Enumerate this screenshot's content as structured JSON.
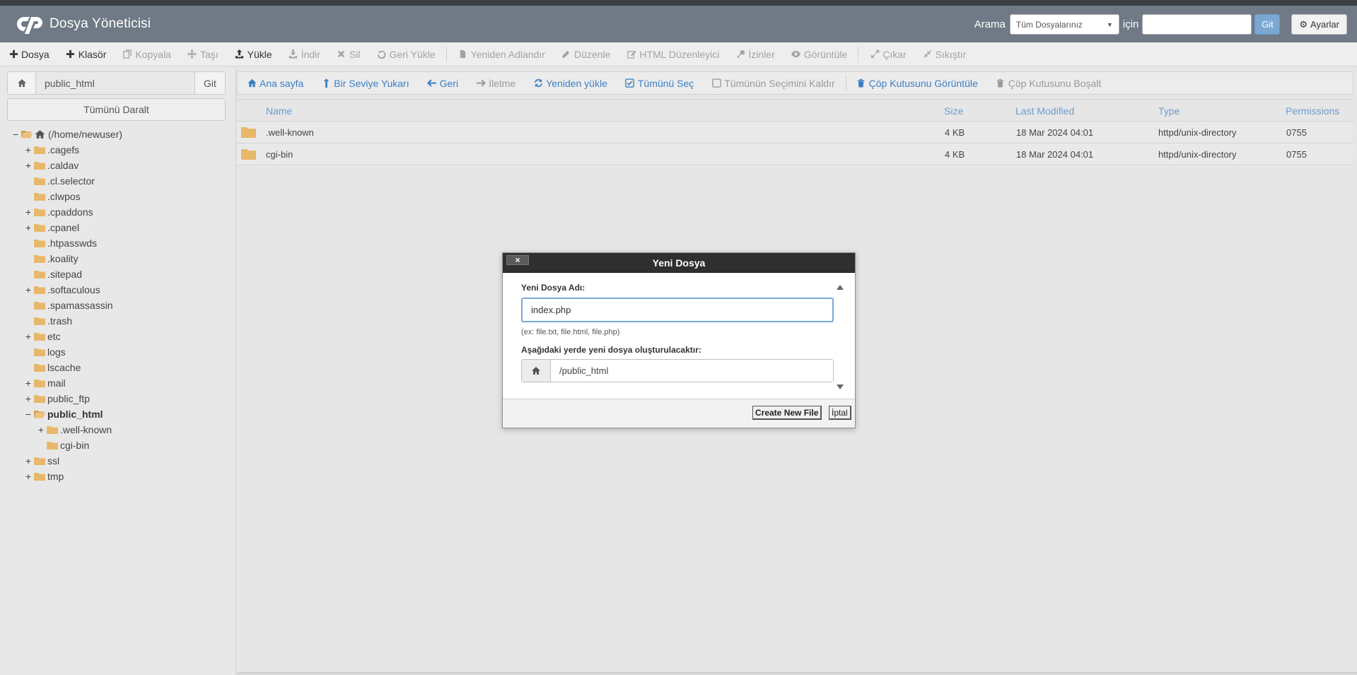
{
  "header": {
    "title": "Dosya Yöneticisi",
    "search_label": "Arama",
    "search_scope": "Tüm Dosyalarınız",
    "search_for": "için",
    "search_value": "",
    "search_go": "Git",
    "settings": "Ayarlar"
  },
  "toolbar": {
    "items": [
      {
        "label": "Dosya",
        "icon": "plus-icon",
        "enabled": true
      },
      {
        "label": "Klasör",
        "icon": "plus-icon",
        "enabled": true
      },
      {
        "label": "Kopyala",
        "icon": "copy-icon",
        "enabled": false
      },
      {
        "label": "Taşı",
        "icon": "move-icon",
        "enabled": false
      },
      {
        "label": "Yükle",
        "icon": "upload-icon",
        "enabled": true
      },
      {
        "label": "İndir",
        "icon": "download-icon",
        "enabled": false
      },
      {
        "label": "Sil",
        "icon": "close-icon",
        "enabled": false
      },
      {
        "label": "Geri Yükle",
        "icon": "undo-icon",
        "enabled": false
      },
      {
        "label": "Yeniden Adlandır",
        "icon": "file-icon",
        "enabled": false
      },
      {
        "label": "Düzenle",
        "icon": "pencil-icon",
        "enabled": false
      },
      {
        "label": "HTML Düzenleyici",
        "icon": "edit-icon",
        "enabled": false
      },
      {
        "label": "İzinler",
        "icon": "key-icon",
        "enabled": false
      },
      {
        "label": "Görüntüle",
        "icon": "eye-icon",
        "enabled": false
      },
      {
        "label": "Çıkar",
        "icon": "expand-icon",
        "enabled": false
      },
      {
        "label": "Sıkıştır",
        "icon": "compress-icon",
        "enabled": false
      }
    ]
  },
  "sidebar": {
    "path_value": "public_html",
    "go_label": "Git",
    "collapse_all": "Tümünü Daralt",
    "tree": [
      {
        "label": "(/home/newuser)",
        "level": 0,
        "toggle": "−",
        "home": true
      },
      {
        "label": ".cagefs",
        "level": 1,
        "toggle": "+"
      },
      {
        "label": ".caldav",
        "level": 1,
        "toggle": "+"
      },
      {
        "label": ".cl.selector",
        "level": 1,
        "toggle": ""
      },
      {
        "label": ".clwpos",
        "level": 1,
        "toggle": ""
      },
      {
        "label": ".cpaddons",
        "level": 1,
        "toggle": "+"
      },
      {
        "label": ".cpanel",
        "level": 1,
        "toggle": "+"
      },
      {
        "label": ".htpasswds",
        "level": 1,
        "toggle": ""
      },
      {
        "label": ".koality",
        "level": 1,
        "toggle": ""
      },
      {
        "label": ".sitepad",
        "level": 1,
        "toggle": ""
      },
      {
        "label": ".softaculous",
        "level": 1,
        "toggle": "+"
      },
      {
        "label": ".spamassassin",
        "level": 1,
        "toggle": ""
      },
      {
        "label": ".trash",
        "level": 1,
        "toggle": ""
      },
      {
        "label": "etc",
        "level": 1,
        "toggle": "+"
      },
      {
        "label": "logs",
        "level": 1,
        "toggle": ""
      },
      {
        "label": "lscache",
        "level": 1,
        "toggle": ""
      },
      {
        "label": "mail",
        "level": 1,
        "toggle": "+"
      },
      {
        "label": "public_ftp",
        "level": 1,
        "toggle": "+"
      },
      {
        "label": "public_html",
        "level": 1,
        "toggle": "−",
        "active": true,
        "open": true
      },
      {
        "label": ".well-known",
        "level": 2,
        "toggle": "+"
      },
      {
        "label": "cgi-bin",
        "level": 2,
        "toggle": ""
      },
      {
        "label": "ssl",
        "level": 1,
        "toggle": "+"
      },
      {
        "label": "tmp",
        "level": 1,
        "toggle": "+"
      }
    ]
  },
  "nav": {
    "items": [
      {
        "label": "Ana sayfa",
        "icon": "home-icon",
        "enabled": true
      },
      {
        "label": "Bir Seviye Yukarı",
        "icon": "level-up-icon",
        "enabled": true
      },
      {
        "label": "Geri",
        "icon": "arrow-left-icon",
        "enabled": true
      },
      {
        "label": "İletme",
        "icon": "arrow-right-icon",
        "enabled": false
      },
      {
        "label": "Yeniden yükle",
        "icon": "refresh-icon",
        "enabled": true
      },
      {
        "label": "Tümünü Seç",
        "icon": "checkbox-checked-icon",
        "enabled": true
      },
      {
        "label": "Tümünün Seçimini Kaldır",
        "icon": "checkbox-empty-icon",
        "enabled": false
      },
      {
        "label": "Çöp Kutusunu Görüntüle",
        "icon": "trash-icon",
        "enabled": true
      },
      {
        "label": "Çöp Kutusunu Boşalt",
        "icon": "trash-icon",
        "enabled": false
      }
    ]
  },
  "table": {
    "headers": {
      "name": "Name",
      "size": "Size",
      "modified": "Last Modified",
      "type": "Type",
      "permissions": "Permissions"
    },
    "rows": [
      {
        "name": ".well-known",
        "size": "4 KB",
        "modified": "18 Mar 2024 04:01",
        "type": "httpd/unix-directory",
        "permissions": "0755"
      },
      {
        "name": "cgi-bin",
        "size": "4 KB",
        "modified": "18 Mar 2024 04:01",
        "type": "httpd/unix-directory",
        "permissions": "0755"
      }
    ]
  },
  "dialog": {
    "title": "Yeni Dosya",
    "close": "×",
    "name_label": "Yeni Dosya Adı:",
    "name_value": "index.php",
    "hint": "(ex: file.txt, file.html, file.php)",
    "location_label": "Aşağıdaki yerde yeni dosya oluşturulacaktır:",
    "location_value": "/public_html",
    "create_label": "Create New File",
    "cancel_label": "İptal"
  },
  "colors": {
    "folder": "#e8b86a",
    "link": "#3b7fc4",
    "header": "#6f7a86"
  }
}
